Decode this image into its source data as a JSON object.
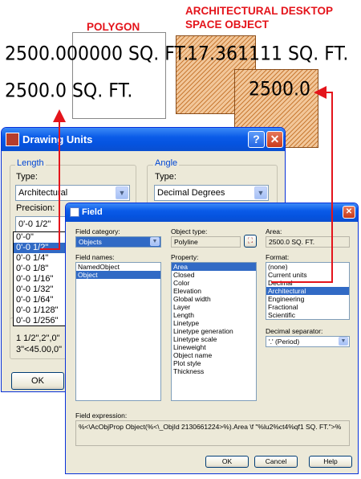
{
  "annotations": {
    "polygon_label": "POLYGON",
    "asd_label_line1": "ARCHITECTURAL DESKTOP",
    "asd_label_line2": "SPACE OBJECT"
  },
  "drawing": {
    "area_decimal": "2500.000000 SQ. FT.",
    "area_asd": "17.361111 SQ. FT.",
    "area_field": "2500.0 SQ. FT.",
    "area_space": "2500.0"
  },
  "drawing_units": {
    "title": "Drawing Units",
    "help_glyph": "?",
    "close_glyph": "✕",
    "length": {
      "group_label": "Length",
      "type_label": "Type:",
      "type_value": "Architectural",
      "precision_label": "Precision:",
      "precision_value": "0'-0 1/2\"",
      "precision_options": [
        "0'-0\"",
        "0'-0 1/2\"",
        "0'-0 1/4\"",
        "0'-0 1/8\"",
        "0'-0 1/16\"",
        "0'-0 1/32\"",
        "0'-0 1/64\"",
        "0'-0 1/128\"",
        "0'-0 1/256\""
      ]
    },
    "angle": {
      "group_label": "Angle",
      "type_label": "Type:",
      "type_value": "Decimal Degrees"
    },
    "sample_line1": "1 1/2\",2\",0\"",
    "sample_line2": "3\"<45.00,0\"",
    "ok_label": "OK"
  },
  "field_dialog": {
    "title": "Field",
    "close_glyph": "✕",
    "category_label": "Field category:",
    "category_value": "Objects",
    "names_label": "Field names:",
    "names": [
      "NamedObject",
      "Object"
    ],
    "names_selected": "Object",
    "object_type_label": "Object type:",
    "object_type_value": "Polyline",
    "property_label": "Property:",
    "properties": [
      "Area",
      "Closed",
      "Color",
      "Elevation",
      "Global width",
      "Layer",
      "Length",
      "Linetype",
      "Linetype generation",
      "Linetype scale",
      "Lineweight",
      "Object name",
      "Plot style",
      "Thickness"
    ],
    "property_selected": "Area",
    "area_label": "Area:",
    "area_value": "2500.0 SQ. FT.",
    "format_label": "Format:",
    "formats": [
      "(none)",
      "Current units",
      "Decimal",
      "Architectural",
      "Engineering",
      "Fractional",
      "Scientific"
    ],
    "format_selected": "Architectural",
    "decimal_sep_label": "Decimal separator:",
    "decimal_sep_value": "'.' (Period)",
    "expression_label": "Field expression:",
    "expression_value": "%<\\AcObjProp Object(%<\\_ObjId 2130661224>%).Area \\f \"%lu2%ct4%qf1 SQ. FT.\">%",
    "ok_label": "OK",
    "cancel_label": "Cancel",
    "help_label": "Help"
  },
  "colors": {
    "annotation_red": "#e4141b",
    "hatch_orange": "#c97b35",
    "xp_blue": "#0a5be8",
    "selection": "#316ac5"
  },
  "icons": {
    "dropdown": "▼",
    "pick": "⛶"
  }
}
